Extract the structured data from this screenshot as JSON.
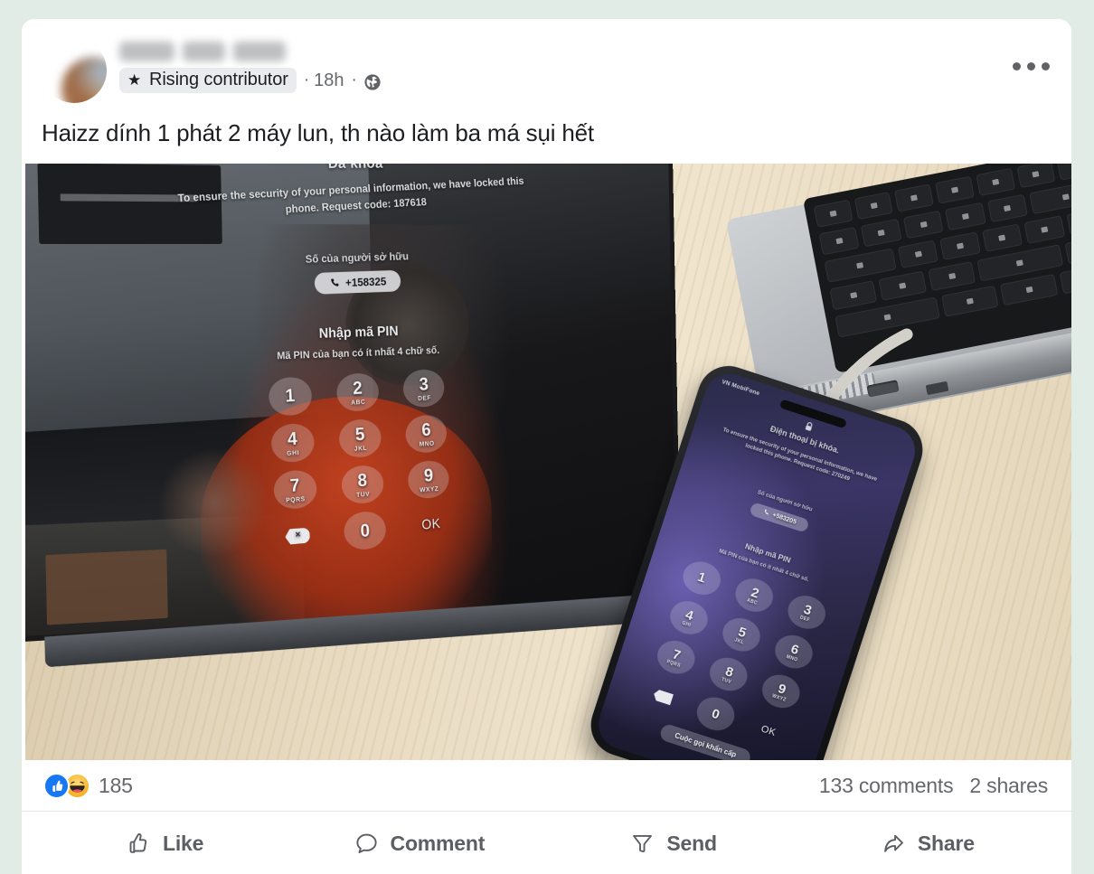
{
  "post": {
    "author_name_redacted": true,
    "badge": {
      "icon": "star-icon",
      "label": "Rising contributor"
    },
    "separator": "·",
    "timestamp": "18h",
    "privacy_icon": "globe-icon",
    "more_menu_icon": "ellipsis-icon",
    "text": "Haizz dính 1 phát 2 máy lun, th nào làm ba má sụi hết"
  },
  "photo": {
    "alt": "Locked tablet and locked phone on a wooden desk next to a laptop",
    "tablet_lockscreen": {
      "lock_icon": "lock-icon",
      "title": "Đã khóa",
      "description": "To ensure the security of your personal information, we have locked this phone. Request code: 187618",
      "owner_label": "Số của người sở hữu",
      "owner_phone": "+158325",
      "phone_icon": "phone-icon",
      "pin_title": "Nhập mã PIN",
      "pin_subtitle": "Mã PIN của bạn có ít nhất 4 chữ số.",
      "keys": [
        {
          "num": "1",
          "sub": ""
        },
        {
          "num": "2",
          "sub": "ABC"
        },
        {
          "num": "3",
          "sub": "DEF"
        },
        {
          "num": "4",
          "sub": "GHI"
        },
        {
          "num": "5",
          "sub": "JKL"
        },
        {
          "num": "6",
          "sub": "MNO"
        },
        {
          "num": "7",
          "sub": "PQRS"
        },
        {
          "num": "8",
          "sub": "TUV"
        },
        {
          "num": "9",
          "sub": "WXYZ"
        },
        {
          "num": "0",
          "sub": ""
        }
      ],
      "delete_icon": "backspace-icon",
      "ok_label": "OK"
    },
    "phone_lockscreen": {
      "carrier": "VN MobiFone",
      "lock_icon": "lock-icon",
      "title": "Điện thoại bị khóa.",
      "description": "To ensure the security of your personal information, we have locked this phone. Request code: 270249",
      "owner_label": "Số của người sở hữu",
      "owner_phone": "+583205",
      "phone_icon": "phone-icon",
      "pin_title": "Nhập mã PIN",
      "pin_subtitle": "Mã PIN của bạn có ít nhất 4 chữ số.",
      "keys": [
        {
          "num": "1",
          "sub": ""
        },
        {
          "num": "2",
          "sub": "ABC"
        },
        {
          "num": "3",
          "sub": "DEF"
        },
        {
          "num": "4",
          "sub": "GHI"
        },
        {
          "num": "5",
          "sub": "JKL"
        },
        {
          "num": "6",
          "sub": "MNO"
        },
        {
          "num": "7",
          "sub": "PQRS"
        },
        {
          "num": "8",
          "sub": "TUV"
        },
        {
          "num": "9",
          "sub": "WXYZ"
        },
        {
          "num": "0",
          "sub": ""
        }
      ],
      "delete_icon": "backspace-icon",
      "ok_label": "OK",
      "emergency_label": "Cuộc gọi khẩn cấp"
    }
  },
  "engagement": {
    "reaction_icons": [
      "like-icon",
      "haha-icon"
    ],
    "reaction_count": "185",
    "comments": "133 comments",
    "shares": "2 shares"
  },
  "actions": [
    {
      "icon": "thumbs-up-icon",
      "label": "Like"
    },
    {
      "icon": "comment-bubble-icon",
      "label": "Comment"
    },
    {
      "icon": "send-icon",
      "label": "Send"
    },
    {
      "icon": "share-arrow-icon",
      "label": "Share"
    }
  ],
  "colors": {
    "page_background": "#e2ece6",
    "card_background": "#ffffff",
    "primary_text": "#1c1e21",
    "secondary_text": "#65676b",
    "facebook_blue": "#1877f2",
    "haha_yellow": "#f7b125",
    "divider": "#e4e6eb",
    "badge_background": "#e9ebee"
  }
}
